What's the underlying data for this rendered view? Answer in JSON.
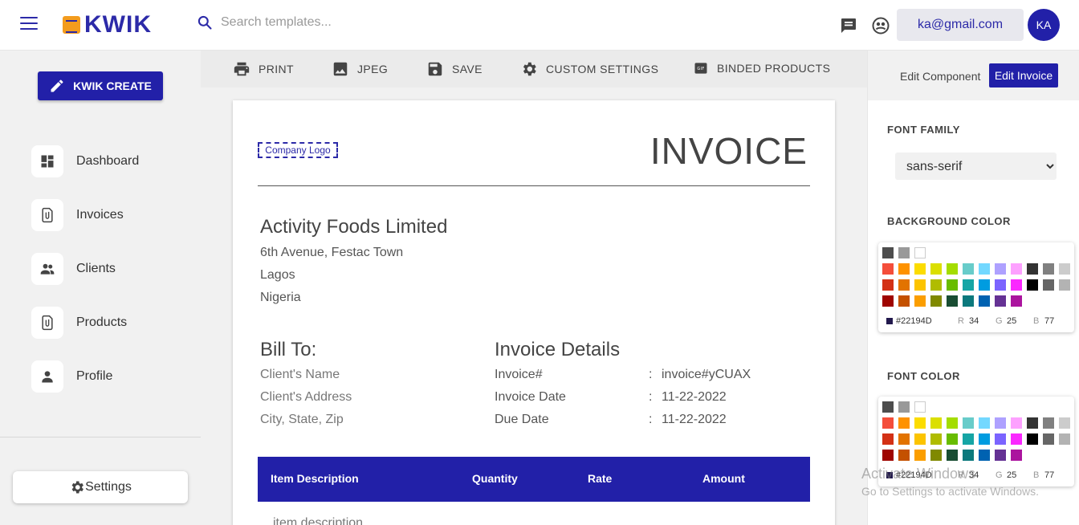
{
  "header": {
    "logo_text_a": "KWIK",
    "search_placeholder": "Search templates...",
    "email": "ka@gmail.com",
    "avatar_initials": "KA"
  },
  "sidebar": {
    "create_label": "KWIK CREATE",
    "items": [
      {
        "label": "Dashboard",
        "icon": "dashboard-icon"
      },
      {
        "label": "Invoices",
        "icon": "invoice-icon"
      },
      {
        "label": "Clients",
        "icon": "clients-icon"
      },
      {
        "label": "Products",
        "icon": "products-icon"
      },
      {
        "label": "Profile",
        "icon": "profile-icon"
      }
    ],
    "settings_label": "Settings"
  },
  "toolbar": {
    "print": "PRINT",
    "jpeg": "JPEG",
    "save": "SAVE",
    "custom_settings": "CUSTOM SETTINGS",
    "binded_products": "BINDED PRODUCTS"
  },
  "invoice": {
    "logo_placeholder": "Company Logo",
    "title": "INVOICE",
    "company": {
      "name": "Activity Foods Limited",
      "address1": "6th Avenue, Festac Town",
      "city": "Lagos",
      "country": "Nigeria"
    },
    "bill_to": {
      "title": "Bill To:",
      "name": "Client's Name",
      "address": "Client's Address",
      "city": "City, State, Zip"
    },
    "details": {
      "title": "Invoice Details",
      "number_label": "Invoice#",
      "number_value": "invoice#yCUAX",
      "date_label": "Invoice Date",
      "date_value": "11-22-2022",
      "due_label": "Due Date",
      "due_value": "11-22-2022",
      "colon": ":"
    },
    "table": {
      "headers": [
        "Item Description",
        "Quantity",
        "Rate",
        "Amount"
      ],
      "first_row_desc": "item description"
    }
  },
  "right_panel": {
    "edit_component": "Edit Component",
    "edit_invoice": "Edit Invoice",
    "font_family_label": "FONT FAMILY",
    "font_family_value": "sans-serif",
    "background_color_label": "BACKGROUND COLOR",
    "font_color_label": "FONT COLOR",
    "picker": {
      "hex": "#22194D",
      "r_label": "R",
      "r": "34",
      "g_label": "G",
      "g": "25",
      "b_label": "B",
      "b": "77"
    },
    "swatch_colors": [
      [
        "#4d4d4d",
        "#999999",
        "#ffffff"
      ],
      [
        "#f44e3b",
        "#fe9200",
        "#fcdc00",
        "#dbdf00",
        "#a4dd00",
        "#68ccca",
        "#73d8ff",
        "#aea1ff",
        "#fda1ff",
        "#333333",
        "#808080",
        "#cccccc"
      ],
      [
        "#d33115",
        "#e27300",
        "#fcc400",
        "#b0bc00",
        "#68bc00",
        "#16a5a5",
        "#009ce0",
        "#7b64ff",
        "#fa28ff",
        "#000000",
        "#666666",
        "#b3b3b3"
      ],
      [
        "#9f0500",
        "#c45100",
        "#fb9e00",
        "#808900",
        "#194d33",
        "#0c797d",
        "#0062b1",
        "#653294",
        "#ab149e"
      ]
    ]
  },
  "watermark": {
    "line1": "Activate Windows",
    "line2": "Go to Settings to activate Windows."
  }
}
